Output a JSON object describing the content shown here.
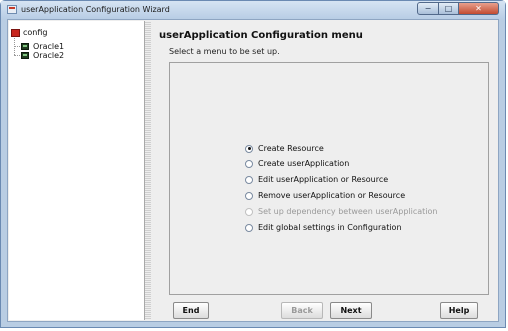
{
  "window": {
    "title": "userApplication Configuration Wizard",
    "controls": {
      "minimize": "−",
      "maximize": "□",
      "close": "✕"
    }
  },
  "tree": {
    "root": {
      "label": "config",
      "icon": "folder-icon"
    },
    "children": [
      {
        "label": "Oracle1",
        "icon": "resource-icon"
      },
      {
        "label": "Oracle2",
        "icon": "resource-icon"
      }
    ]
  },
  "main": {
    "title": "userApplication Configuration menu",
    "subtitle": "Select a menu to be set up.",
    "selected_option": "Create Resource",
    "options": [
      {
        "label": "Create Resource",
        "selected": true,
        "enabled": true
      },
      {
        "label": "Create userApplication",
        "selected": false,
        "enabled": true
      },
      {
        "label": "Edit userApplication or Resource",
        "selected": false,
        "enabled": true
      },
      {
        "label": "Remove userApplication or Resource",
        "selected": false,
        "enabled": true
      },
      {
        "label": "Set up dependency between userApplication",
        "selected": false,
        "enabled": false
      },
      {
        "label": "Edit global settings in Configuration",
        "selected": false,
        "enabled": true
      }
    ]
  },
  "buttons": {
    "end": "End",
    "back": "Back",
    "next": "Next",
    "help": "Help",
    "back_enabled": false
  }
}
